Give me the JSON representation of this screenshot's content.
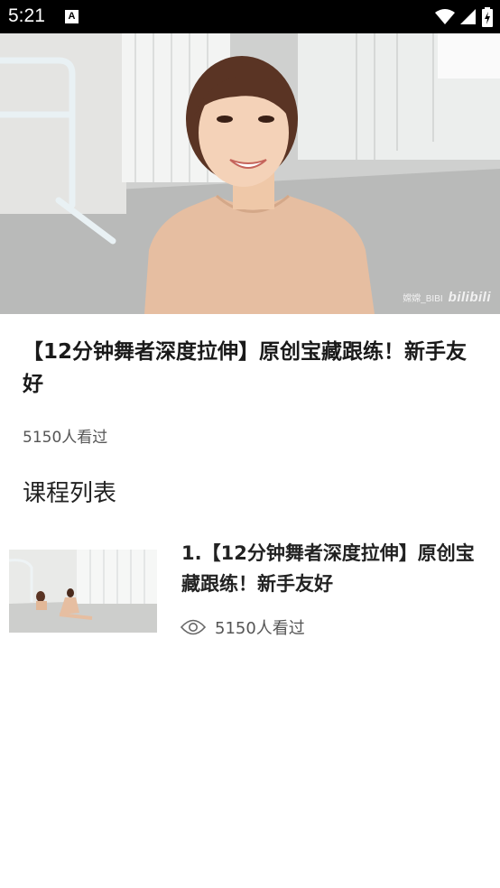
{
  "status_bar": {
    "time": "5:21",
    "notification_icon": "a-icon",
    "icons": [
      "wifi-icon",
      "signal-icon",
      "battery-charging-icon"
    ]
  },
  "video": {
    "watermark_text": "嫦嫦_BIBI",
    "watermark_logo": "bilibili"
  },
  "main": {
    "title": "【12分钟舞者深度拉伸】原创宝藏跟练！新手友好",
    "views": "5150人看过"
  },
  "section": {
    "title": "课程列表"
  },
  "course_list": [
    {
      "title": "1.【12分钟舞者深度拉伸】原创宝藏跟练！新手友好",
      "views": "5150人看过",
      "icon": "eye-icon"
    }
  ]
}
